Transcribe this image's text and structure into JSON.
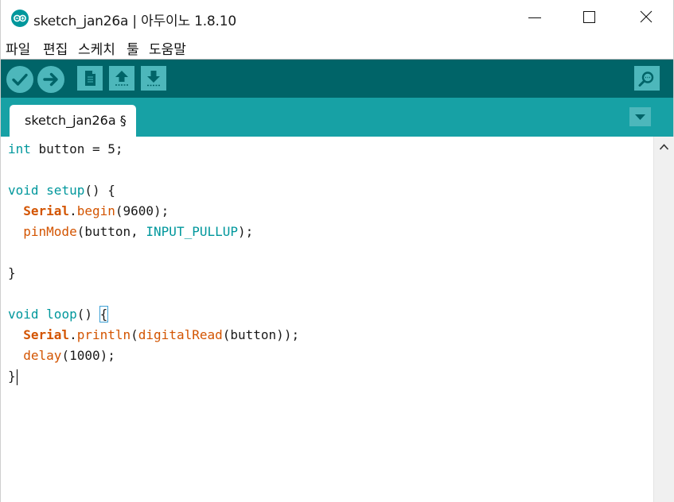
{
  "window": {
    "title": "sketch_jan26a | 아두이노 1.8.10"
  },
  "menubar": {
    "items": [
      "파일",
      "편집",
      "스케치",
      "툴",
      "도움말"
    ]
  },
  "toolbar": {
    "buttons": [
      "verify-icon",
      "upload-icon",
      "new-icon",
      "open-icon",
      "save-icon",
      "serial-monitor-icon"
    ]
  },
  "tabs": {
    "active_label": "sketch_jan26a §"
  },
  "editor": {
    "lines": [
      [
        {
          "t": "int",
          "c": "kw"
        },
        {
          "t": " button = 5;",
          "c": ""
        }
      ],
      [],
      [
        {
          "t": "void",
          "c": "kw"
        },
        {
          "t": " ",
          "c": ""
        },
        {
          "t": "setup",
          "c": "kw"
        },
        {
          "t": "() {",
          "c": ""
        }
      ],
      [
        {
          "t": "  ",
          "c": ""
        },
        {
          "t": "Serial",
          "c": "obj"
        },
        {
          "t": ".",
          "c": ""
        },
        {
          "t": "begin",
          "c": "fn"
        },
        {
          "t": "(9600);",
          "c": ""
        }
      ],
      [
        {
          "t": "  ",
          "c": ""
        },
        {
          "t": "pinMode",
          "c": "fn"
        },
        {
          "t": "(button, ",
          "c": ""
        },
        {
          "t": "INPUT_PULLUP",
          "c": "const"
        },
        {
          "t": ");",
          "c": ""
        }
      ],
      [],
      [
        {
          "t": "}",
          "c": ""
        }
      ],
      [],
      [
        {
          "t": "void",
          "c": "kw"
        },
        {
          "t": " ",
          "c": ""
        },
        {
          "t": "loop",
          "c": "kw"
        },
        {
          "t": "() ",
          "c": ""
        },
        {
          "t": "{",
          "c": "brace"
        }
      ],
      [
        {
          "t": "  ",
          "c": ""
        },
        {
          "t": "Serial",
          "c": "obj"
        },
        {
          "t": ".",
          "c": ""
        },
        {
          "t": "println",
          "c": "fn"
        },
        {
          "t": "(",
          "c": ""
        },
        {
          "t": "digitalRead",
          "c": "fn"
        },
        {
          "t": "(button));",
          "c": ""
        }
      ],
      [
        {
          "t": "  ",
          "c": ""
        },
        {
          "t": "delay",
          "c": "fn"
        },
        {
          "t": "(1000);",
          "c": ""
        }
      ],
      [
        {
          "t": "}",
          "c": "caret"
        }
      ]
    ]
  },
  "colors": {
    "toolbar_bg": "#006468",
    "tabstrip_bg": "#17a1a5",
    "button_bg": "#4db7bb",
    "keyword": "#00979c",
    "function": "#d35400"
  }
}
